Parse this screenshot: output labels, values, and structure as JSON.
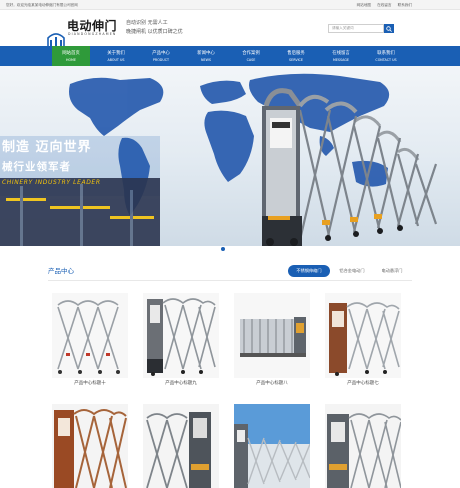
{
  "topbar": {
    "welcome": "您好，欢迎光临某某电动伸缩门有限公司官网",
    "links": [
      "网站地图",
      "在线留言",
      "联系我们"
    ]
  },
  "header": {
    "logo_cn": "电动伸门",
    "logo_en": "DIANDONGZHAMEN",
    "slogan_line1": "自动识别 无需人工",
    "slogan_line2": "晚捷闸机 以优质口碑之优",
    "search_placeholder": "请输入关键词"
  },
  "nav": {
    "items": [
      {
        "cn": "网站首页",
        "en": "HOME"
      },
      {
        "cn": "关于我们",
        "en": "ABOUT US"
      },
      {
        "cn": "产品中心",
        "en": "PRODUCT"
      },
      {
        "cn": "新闻中心",
        "en": "NEWS"
      },
      {
        "cn": "合作案例",
        "en": "CASE"
      },
      {
        "cn": "售后服务",
        "en": "SERVICE"
      },
      {
        "cn": "在线留言",
        "en": "MESSAGE"
      },
      {
        "cn": "联系我们",
        "en": "CONTACT US"
      }
    ],
    "active_index": 0
  },
  "banner": {
    "line1": "制造  迈向世界",
    "line2": "械行业领军者",
    "line3": "CHINERY INDUSTRY LEADER",
    "slides": 2,
    "active_slide": 1
  },
  "products": {
    "title": "产品中心",
    "tabs": [
      "不锈钢伸缩门",
      "铝合金电动门",
      "电动悬浮门"
    ],
    "active_tab": 0,
    "row1": [
      {
        "caption": "产品中心标题十",
        "icon": "retractable-gate-image"
      },
      {
        "caption": "产品中心标题九",
        "icon": "retractable-gate-image"
      },
      {
        "caption": "产品中心标题八",
        "icon": "retractable-gate-image"
      },
      {
        "caption": "产品中心标题七",
        "icon": "retractable-gate-image"
      }
    ],
    "row2": [
      {
        "icon": "retractable-gate-image"
      },
      {
        "icon": "retractable-gate-image"
      },
      {
        "icon": "retractable-gate-image"
      },
      {
        "icon": "retractable-gate-image"
      }
    ]
  },
  "colors": {
    "brand_blue": "#1a5fb4",
    "active_green": "#2f9a3a",
    "banner_yellow": "#f2c20c"
  }
}
